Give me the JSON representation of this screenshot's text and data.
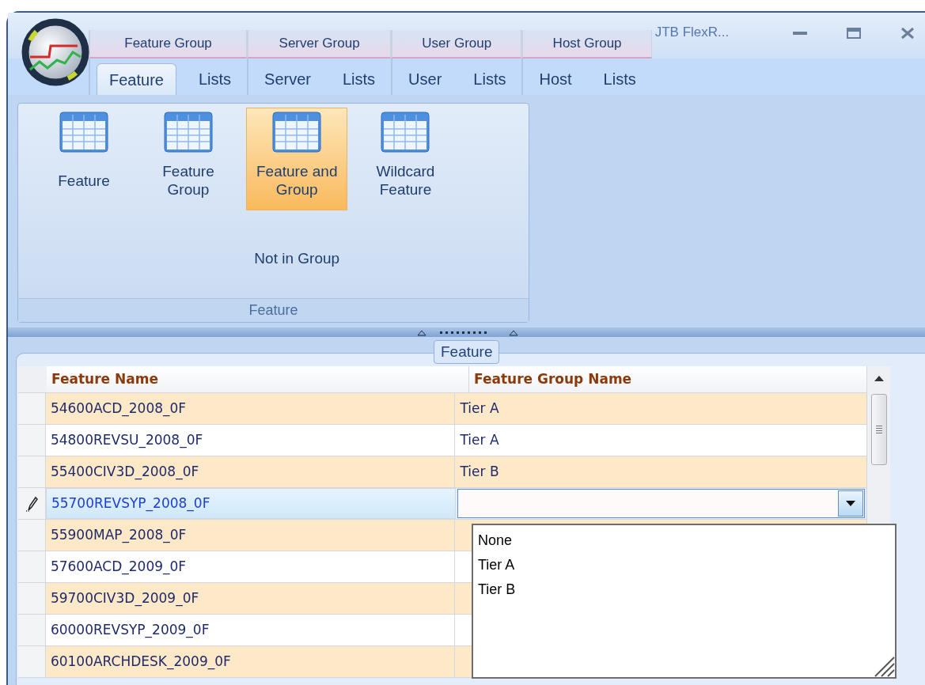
{
  "window": {
    "title": "JTB FlexR..."
  },
  "tab_groups": [
    {
      "label": "Feature Group",
      "tabs": [
        {
          "label": "Feature",
          "selected": true
        },
        {
          "label": "Lists",
          "selected": false
        }
      ]
    },
    {
      "label": "Server Group",
      "tabs": [
        {
          "label": "Server",
          "selected": false
        },
        {
          "label": "Lists",
          "selected": false
        }
      ]
    },
    {
      "label": "User Group",
      "tabs": [
        {
          "label": "User",
          "selected": false
        },
        {
          "label": "Lists",
          "selected": false
        }
      ]
    },
    {
      "label": "Host Group",
      "tabs": [
        {
          "label": "Host",
          "selected": false
        },
        {
          "label": "Lists",
          "selected": false
        }
      ]
    }
  ],
  "ribbon": {
    "group_label": "Feature",
    "columns": [
      {
        "items": [
          {
            "kind": "large",
            "label": "Feature",
            "highlighted": false
          }
        ]
      },
      {
        "items": [
          {
            "kind": "large",
            "label": "Feature\nGroup",
            "highlighted": false
          }
        ]
      },
      {
        "items": [
          {
            "kind": "large",
            "label": "Feature and\nGroup",
            "highlighted": true
          },
          {
            "kind": "small",
            "label": "Not in Group",
            "highlighted": false
          }
        ]
      },
      {
        "items": [
          {
            "kind": "large",
            "label": "Wildcard\nFeature",
            "highlighted": false
          }
        ]
      }
    ]
  },
  "grid": {
    "caption": "Feature",
    "columns": [
      "Feature Name",
      "Feature Group Name"
    ],
    "rows": [
      {
        "feature_name": "54600ACD_2008_0F",
        "group_name": "Tier A",
        "selected": false,
        "editing": false
      },
      {
        "feature_name": "54800REVSU_2008_0F",
        "group_name": "Tier A",
        "selected": false,
        "editing": false
      },
      {
        "feature_name": "55400CIV3D_2008_0F",
        "group_name": "Tier B",
        "selected": false,
        "editing": false
      },
      {
        "feature_name": "55700REVSYP_2008_0F",
        "selected": true,
        "editing": true
      },
      {
        "feature_name": "55900MAP_2008_0F",
        "selected": false,
        "editing": false
      },
      {
        "feature_name": "57600ACD_2009_0F",
        "selected": false,
        "editing": false
      },
      {
        "feature_name": "59700CIV3D_2009_0F",
        "selected": false,
        "editing": false
      },
      {
        "feature_name": "60000REVSYP_2009_0F",
        "selected": false,
        "editing": false
      },
      {
        "feature_name": "60100ARCHDESK_2009_0F",
        "selected": false,
        "editing": false
      }
    ]
  },
  "dropdown": {
    "options": [
      "None",
      "Tier A",
      "Tier B"
    ]
  }
}
